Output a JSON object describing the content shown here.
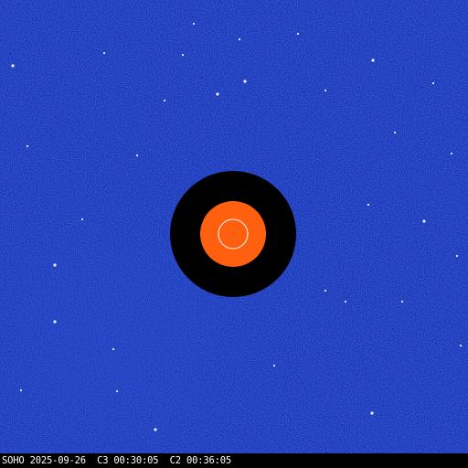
{
  "image": {
    "kind": "coronagraph-difference-image",
    "background_color": "#1636b8",
    "occulter_color": "#000000",
    "sun_disk_color": "#ff6010",
    "sun_outline_color": "#ffffff",
    "star_color": "#e8f0ff"
  },
  "caption": {
    "text": "SOHO 2025-09-26  C3 00:30:05  C2 00:36:05"
  }
}
